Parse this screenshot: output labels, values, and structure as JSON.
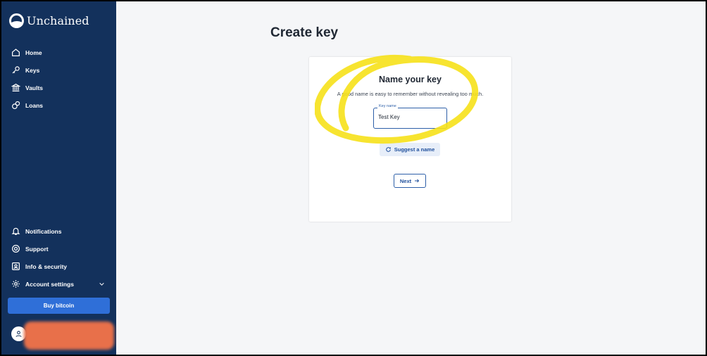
{
  "app": {
    "name": "Unchained"
  },
  "sidebar": {
    "top_items": [
      {
        "label": "Home",
        "icon": "home-icon"
      },
      {
        "label": "Keys",
        "icon": "key-icon"
      },
      {
        "label": "Vaults",
        "icon": "vault-icon"
      },
      {
        "label": "Loans",
        "icon": "loan-icon"
      }
    ],
    "bottom_items": [
      {
        "label": "Notifications",
        "icon": "bell-icon"
      },
      {
        "label": "Support",
        "icon": "support-icon"
      },
      {
        "label": "Info & security",
        "icon": "id-badge-icon"
      },
      {
        "label": "Account settings",
        "icon": "gear-icon"
      }
    ],
    "buy_button": "Buy bitcoin"
  },
  "page": {
    "title": "Create key"
  },
  "card": {
    "title": "Name your key",
    "subtitle": "A good name is easy to remember without revealing too much.",
    "field_label": "Key name",
    "field_value": "Test Key",
    "suggest_label": "Suggest a name",
    "next_label": "Next"
  },
  "colors": {
    "sidebar_bg": "#13315c",
    "accent": "#2f6fd8",
    "highlight": "#f7e21a"
  }
}
